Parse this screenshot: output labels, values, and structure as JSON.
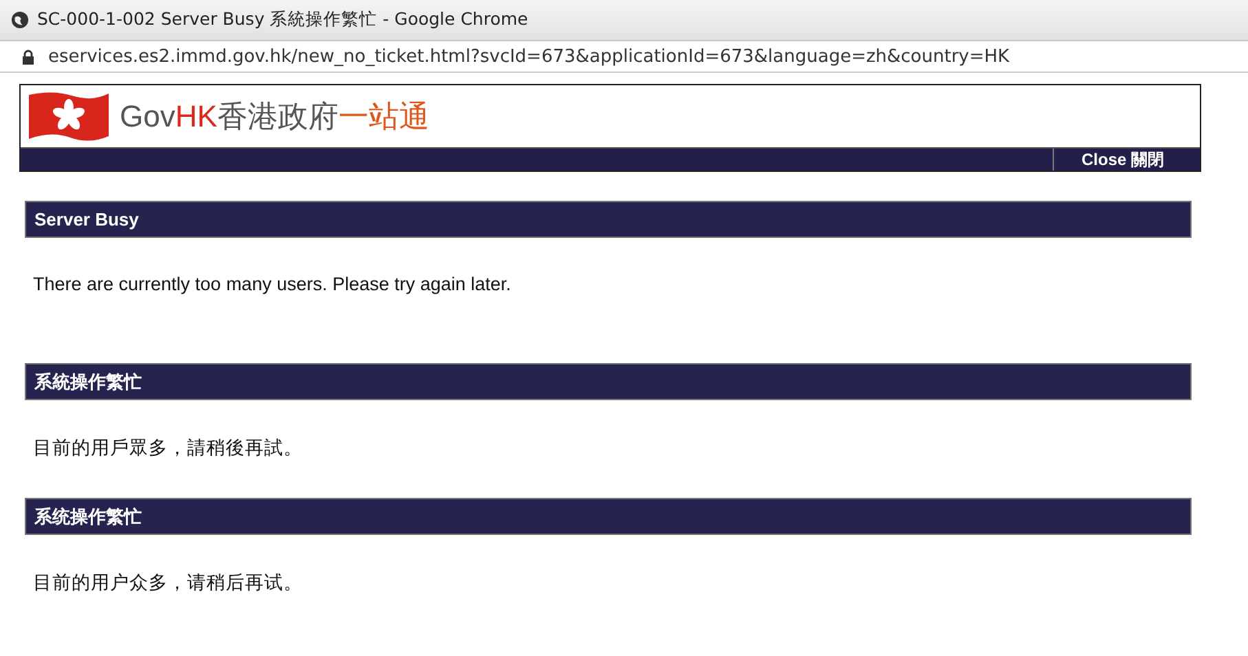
{
  "window": {
    "title": "SC-000-1-002 Server Busy 系統操作繁忙 - Google Chrome"
  },
  "address_bar": {
    "url": "eservices.es2.immd.gov.hk/new_no_ticket.html?svcId=673&applicationId=673&language=zh&country=HK"
  },
  "header": {
    "logo": [
      {
        "text": "Gov",
        "kind": "grey"
      },
      {
        "text": "HK",
        "kind": "red"
      },
      {
        "text": "香港政府",
        "kind": "grey"
      },
      {
        "text": "一站通",
        "kind": "orange"
      }
    ],
    "close_button": "Close 關閉"
  },
  "sections": [
    {
      "title": "Server Busy",
      "message": "There are currently too many users. Please try again later."
    },
    {
      "title": "系統操作繁忙",
      "message": "目前的用戶眾多，請稍後再試。"
    },
    {
      "title": "系统操作繁忙",
      "message": "目前的用户众多，请稍后再试。"
    }
  ]
}
